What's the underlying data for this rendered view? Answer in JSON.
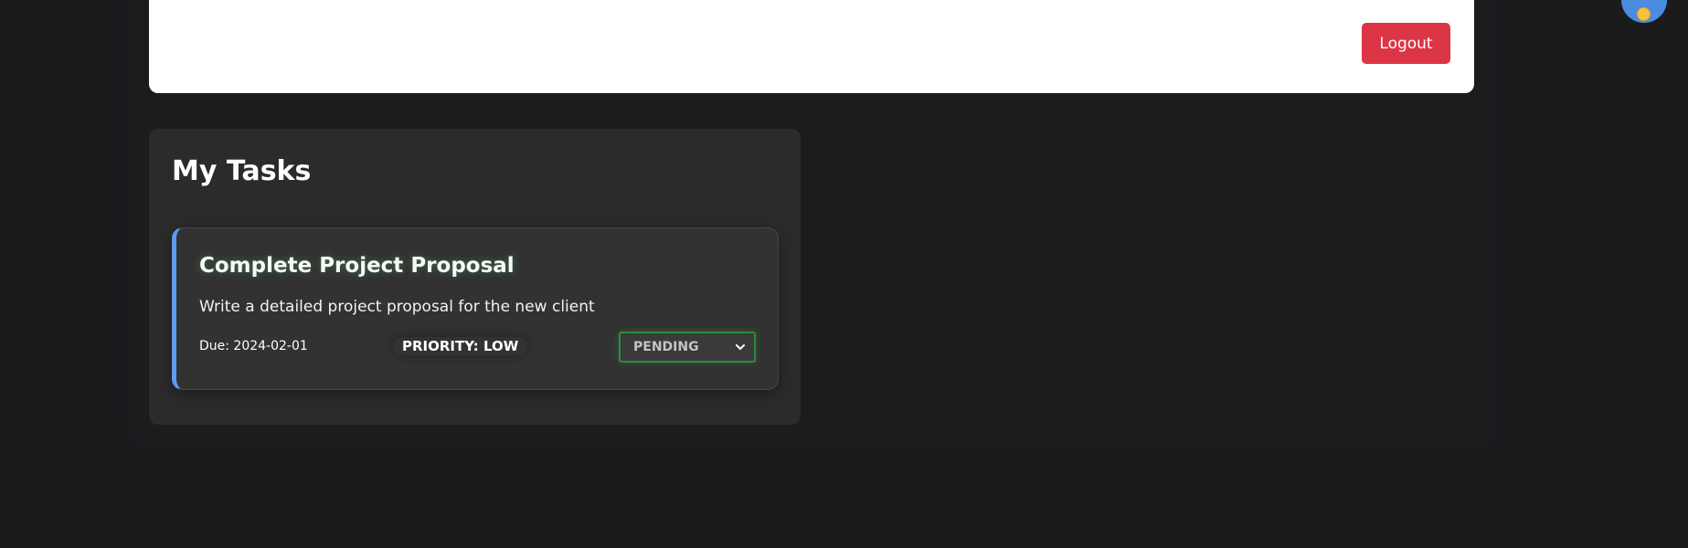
{
  "header": {
    "logout_label": "Logout",
    "logout_color": "#dc3545"
  },
  "tasks_panel": {
    "title": "My Tasks",
    "tasks": [
      {
        "title": "Complete Project Proposal",
        "description": "Write a detailed project proposal for the new client",
        "due": "Due: 2024-02-01",
        "priority": "PRIORITY: LOW",
        "status": "PENDING",
        "accent_color": "#5b9cf2",
        "status_border_color": "#2e8b3e"
      }
    ]
  },
  "theme_toggle": {
    "icon": "sun-icon",
    "button_color": "#4a8ce0",
    "icon_color": "#f5c142"
  },
  "colors": {
    "background": "#1b1b1b",
    "panel": "#2b2b2b",
    "card": "#323232"
  }
}
